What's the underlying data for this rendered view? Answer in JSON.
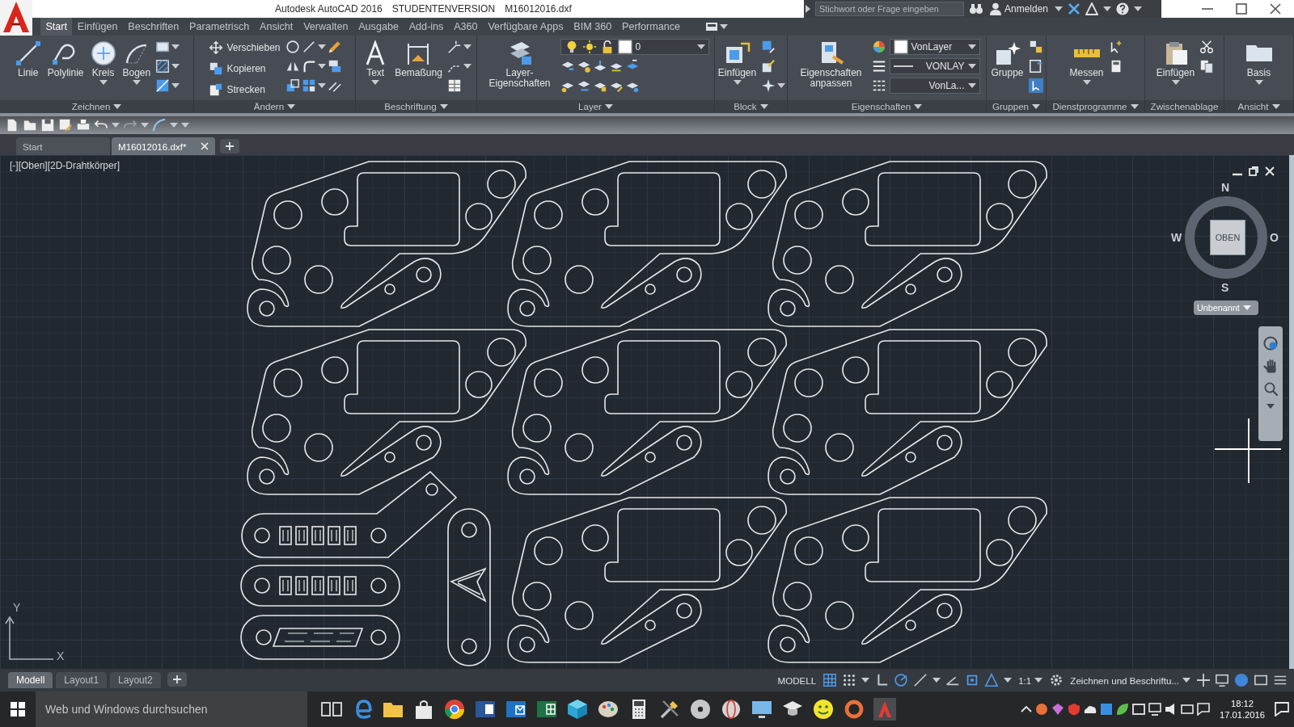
{
  "window": {
    "title": "Autodesk AutoCAD 2016",
    "edition": "STUDENTENVERSION",
    "file": "M16012016.dxf"
  },
  "search": {
    "placeholder": "Stichwort oder Frage eingeben"
  },
  "sign_in": "Anmelden",
  "ribbon_tabs": [
    {
      "label": "Start",
      "selected": true
    },
    {
      "label": "Einfügen",
      "selected": false
    },
    {
      "label": "Beschriften",
      "selected": false
    },
    {
      "label": "Parametrisch",
      "selected": false
    },
    {
      "label": "Ansicht",
      "selected": false
    },
    {
      "label": "Verwalten",
      "selected": false
    },
    {
      "label": "Ausgabe",
      "selected": false
    },
    {
      "label": "Add-ins",
      "selected": false
    },
    {
      "label": "A360",
      "selected": false
    },
    {
      "label": "Verfügbare Apps",
      "selected": false
    },
    {
      "label": "BIM 360",
      "selected": false
    },
    {
      "label": "Performance",
      "selected": false
    }
  ],
  "ribbon_panels": [
    {
      "title": "Zeichnen",
      "expandable": true,
      "tools": [
        {
          "kind": "large",
          "label": "Linie",
          "has_menu": false
        },
        {
          "kind": "large",
          "label": "Polylinie",
          "has_menu": false
        },
        {
          "kind": "large",
          "label": "Kreis",
          "has_menu": true
        },
        {
          "kind": "large",
          "label": "Bogen",
          "has_menu": true
        }
      ]
    },
    {
      "title": "Ändern",
      "expandable": true,
      "tools": [
        {
          "kind": "small",
          "label": "Verschieben",
          "has_menu": false
        },
        {
          "kind": "small",
          "label": "Kopieren",
          "has_menu": false
        },
        {
          "kind": "small",
          "label": "Strecken",
          "has_menu": false
        }
      ]
    },
    {
      "title": "Beschriftung",
      "expandable": true,
      "tools": [
        {
          "kind": "large",
          "label": "Text",
          "has_menu": true
        },
        {
          "kind": "large",
          "label": "Bemaßung",
          "has_menu": false
        }
      ]
    },
    {
      "title": "Layer",
      "expandable": true,
      "tools": [
        {
          "kind": "large",
          "label": "Layer-Eigenschaften",
          "has_menu": false
        },
        {
          "kind": "dropdown",
          "value": "0"
        }
      ]
    },
    {
      "title": "Block",
      "expandable": true,
      "tools": [
        {
          "kind": "large",
          "label": "Einfügen",
          "has_menu": true
        }
      ]
    },
    {
      "title": "Eigenschaften",
      "expandable": true,
      "tools": [
        {
          "kind": "large",
          "label": "Eigenschaften anpassen",
          "has_menu": false
        },
        {
          "kind": "dropdown",
          "value": "VonLayer"
        },
        {
          "kind": "dropdown",
          "value": "VONLAY"
        },
        {
          "kind": "dropdown",
          "value": "VonLa..."
        }
      ]
    },
    {
      "title": "Gruppen",
      "expandable": true,
      "tools": [
        {
          "kind": "large",
          "label": "Gruppe",
          "has_menu": false
        }
      ]
    },
    {
      "title": "Dienstprogramme",
      "expandable": true,
      "tools": [
        {
          "kind": "large",
          "label": "Messen",
          "has_menu": true
        }
      ]
    },
    {
      "title": "Zwischenablage",
      "expandable": false,
      "tools": [
        {
          "kind": "large",
          "label": "Einfügen",
          "has_menu": true
        }
      ]
    },
    {
      "title": "Ansicht",
      "expandable": true,
      "tools": [
        {
          "kind": "large",
          "label": "Basis",
          "has_menu": true
        }
      ]
    }
  ],
  "doc_tabs": [
    {
      "label": "Start",
      "selected": false,
      "closable": false
    },
    {
      "label": "M16012016.dxf*",
      "selected": true,
      "closable": true
    }
  ],
  "viewport": {
    "label": "[-][Oben][2D-Drahtkörper]",
    "viewcube": {
      "north": "N",
      "west": "W",
      "east": "O",
      "south": "S",
      "face": "OBEN",
      "ucs": "Unbenannt"
    },
    "axes": {
      "y": "Y",
      "x": "X"
    }
  },
  "layout_tabs": [
    {
      "label": "Modell",
      "selected": true
    },
    {
      "label": "Layout1",
      "selected": false
    },
    {
      "label": "Layout2",
      "selected": false
    }
  ],
  "status_bar": {
    "space": "MODELL",
    "toggles": [
      {
        "on": true
      },
      {
        "on": false
      },
      {
        "on": false
      },
      {
        "on": true
      },
      {
        "on": false
      },
      {
        "on": false
      },
      {
        "on": true
      },
      {
        "on": true
      }
    ],
    "scale": "1:1",
    "workspace": "Zeichnen und Beschriftu..."
  },
  "taskbar": {
    "search": {
      "placeholder": "Web und Windows durchsuchen"
    },
    "time": "18:12",
    "date": "17.01.2016"
  }
}
